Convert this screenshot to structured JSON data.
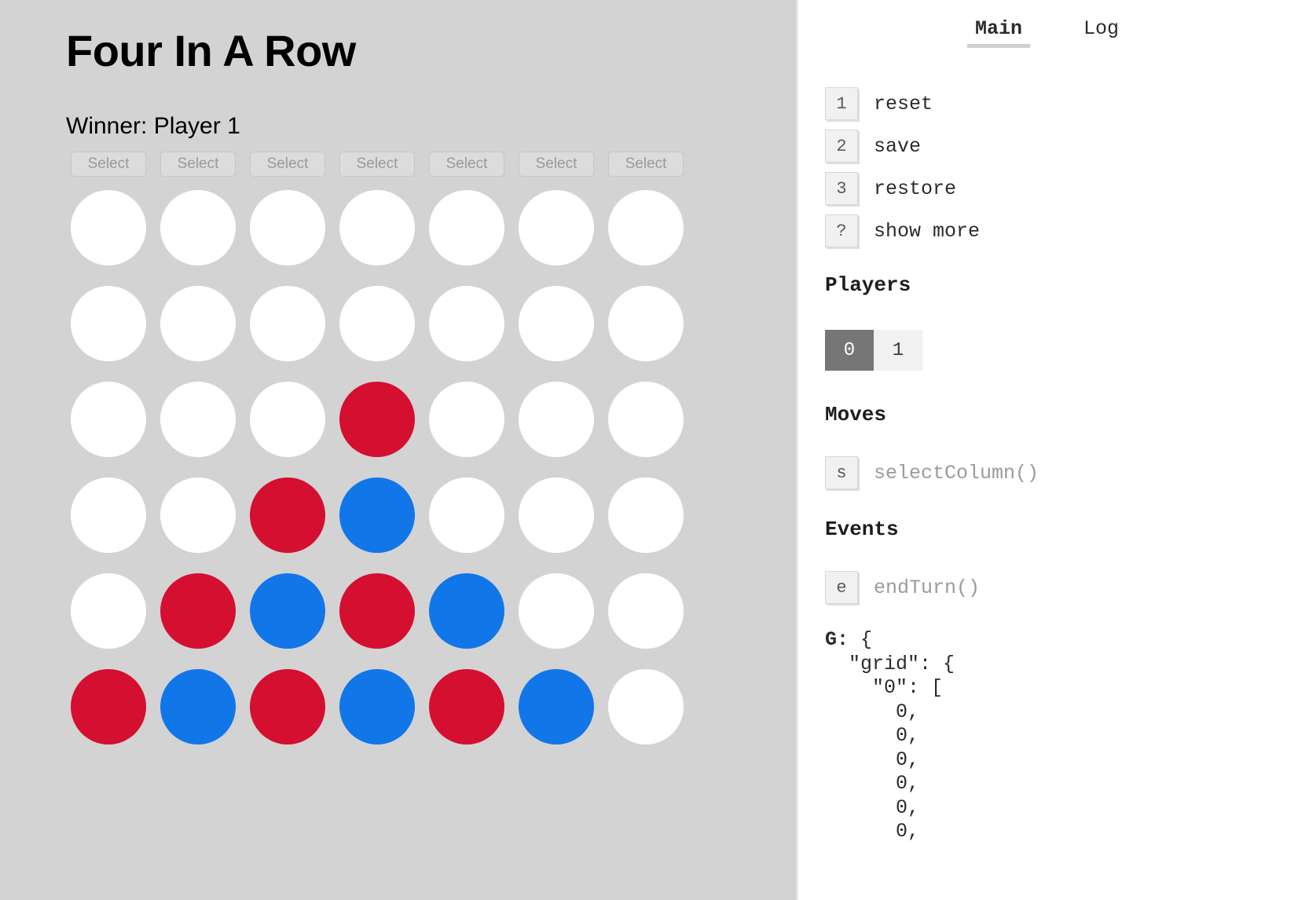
{
  "game": {
    "title": "Four In A Row",
    "status": "Winner: Player 1",
    "select_label": "Select",
    "columns": 7,
    "rows": 6,
    "colors": {
      "empty": "#ffffff",
      "player0": "#d50f30",
      "player1": "#1176e8",
      "board_bg": "#d3d3d3"
    },
    "grid": [
      [
        "empty",
        "empty",
        "empty",
        "empty",
        "empty",
        "empty",
        "empty"
      ],
      [
        "empty",
        "empty",
        "empty",
        "empty",
        "empty",
        "empty",
        "empty"
      ],
      [
        "empty",
        "empty",
        "empty",
        "p0",
        "empty",
        "empty",
        "empty"
      ],
      [
        "empty",
        "empty",
        "p0",
        "p1",
        "empty",
        "empty",
        "empty"
      ],
      [
        "empty",
        "p0",
        "p1",
        "p0",
        "p1",
        "empty",
        "empty"
      ],
      [
        "p0",
        "p1",
        "p0",
        "p1",
        "p0",
        "p1",
        "empty"
      ]
    ]
  },
  "panel": {
    "tabs": [
      {
        "label": "Main",
        "active": true
      },
      {
        "label": "Log",
        "active": false
      }
    ],
    "controls": [
      {
        "key": "1",
        "label": "reset",
        "muted": false
      },
      {
        "key": "2",
        "label": "save",
        "muted": false
      },
      {
        "key": "3",
        "label": "restore",
        "muted": false
      },
      {
        "key": "?",
        "label": "show more",
        "muted": false
      }
    ],
    "players_heading": "Players",
    "players": [
      {
        "label": "0",
        "active": true
      },
      {
        "label": "1",
        "active": false
      }
    ],
    "moves_heading": "Moves",
    "moves": [
      {
        "key": "s",
        "label": "selectColumn()",
        "muted": true
      }
    ],
    "events_heading": "Events",
    "events": [
      {
        "key": "e",
        "label": "endTurn()",
        "muted": true
      }
    ],
    "gstate_key": "G:",
    "gstate_lines": [
      " {",
      "  \"grid\": {",
      "    \"0\": [",
      "      0,",
      "      0,",
      "      0,",
      "      0,",
      "      0,",
      "      0,"
    ]
  }
}
